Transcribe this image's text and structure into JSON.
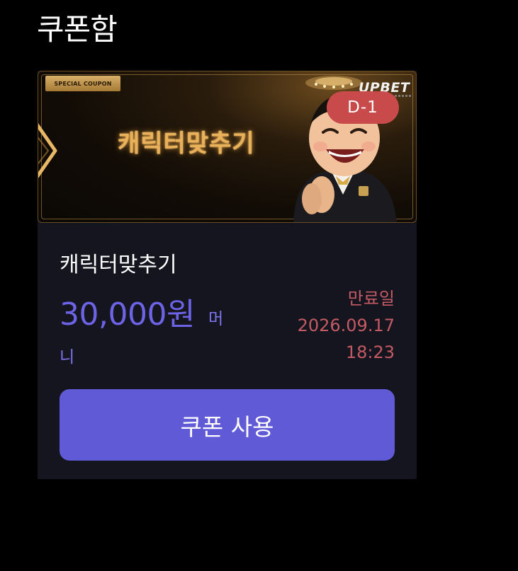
{
  "header": {
    "title": "쿠폰함"
  },
  "coupon": {
    "banner": {
      "tag": "SPECIAL COUPON",
      "title": "캐릭터맞추기",
      "brand": "UPBET",
      "days_left_badge": "D-1"
    },
    "name": "캐릭터맞추기",
    "amount": "30,000원",
    "currency_type": "머니",
    "expiry": {
      "label": "만료일",
      "date": "2026.09.17",
      "time": "18:23"
    },
    "use_button_label": "쿠폰 사용"
  },
  "colors": {
    "background": "#000000",
    "card": "#15151f",
    "accent": "#615ad7",
    "amount": "#6c63e6",
    "expiry": "#c45a63",
    "badge": "#c94a4a",
    "banner_gold": "#e9b25a"
  }
}
